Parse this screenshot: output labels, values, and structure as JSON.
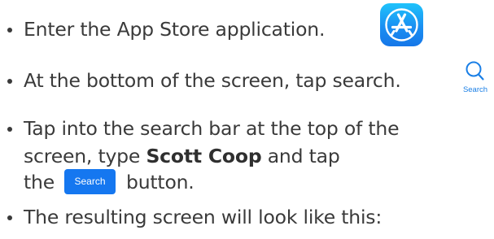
{
  "items": [
    {
      "text": "Enter the App Store application.",
      "icon": "app-store-icon"
    },
    {
      "text": "At the bottom of the screen, tap search.",
      "icon": "search-tab-icon",
      "icon_label": "Search"
    },
    {
      "line1": "Tap into the search bar at the top of the",
      "line2_pre": "screen, type ",
      "line2_bold": "Scott Coop",
      "line2_post": " and tap",
      "line3_pre": "the ",
      "button_label": "Search",
      "line3_post": "button."
    },
    {
      "text": "The resulting screen will look like this:"
    }
  ],
  "colors": {
    "text": "#3a3a3a",
    "accent_blue": "#1577f0",
    "app_store_gradient_top": "#1fc3fb",
    "app_store_gradient_bottom": "#1677e8"
  }
}
